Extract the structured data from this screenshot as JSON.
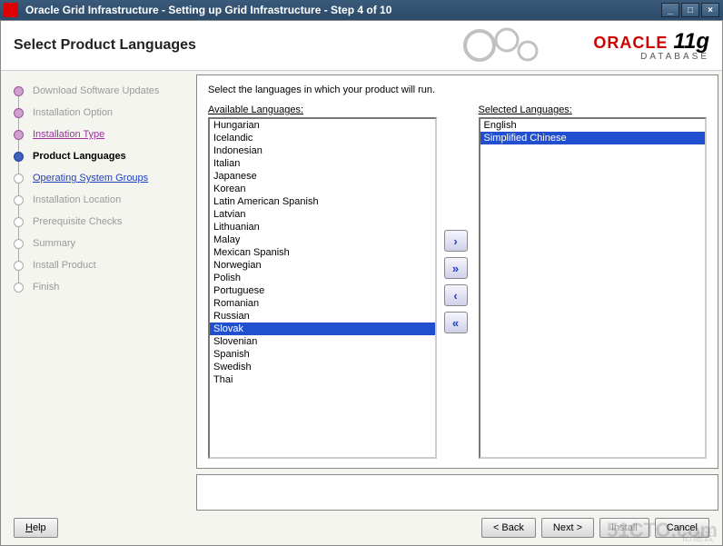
{
  "window": {
    "title": "Oracle Grid Infrastructure - Setting up Grid Infrastructure - Step 4 of 10"
  },
  "header": {
    "title": "Select Product Languages",
    "logo_brand": "ORACLE",
    "logo_product": "11g",
    "logo_sub": "DATABASE"
  },
  "steps": [
    {
      "label": "Download Software Updates",
      "state": "disabled"
    },
    {
      "label": "Installation Option",
      "state": "disabled"
    },
    {
      "label": "Installation Type",
      "state": "visited-link"
    },
    {
      "label": "Product Languages",
      "state": "current"
    },
    {
      "label": "Operating System Groups",
      "state": "link"
    },
    {
      "label": "Installation Location",
      "state": "disabled"
    },
    {
      "label": "Prerequisite Checks",
      "state": "disabled"
    },
    {
      "label": "Summary",
      "state": "disabled"
    },
    {
      "label": "Install Product",
      "state": "disabled"
    },
    {
      "label": "Finish",
      "state": "disabled"
    }
  ],
  "main": {
    "instruction": "Select the languages in which your product will run.",
    "available_label": "Available Languages:",
    "selected_label": "Selected Languages:",
    "available": [
      "Hungarian",
      "Icelandic",
      "Indonesian",
      "Italian",
      "Japanese",
      "Korean",
      "Latin American Spanish",
      "Latvian",
      "Lithuanian",
      "Malay",
      "Mexican Spanish",
      "Norwegian",
      "Polish",
      "Portuguese",
      "Romanian",
      "Russian",
      "Slovak",
      "Slovenian",
      "Spanish",
      "Swedish",
      "Thai"
    ],
    "available_selected_index": 16,
    "selected": [
      "English",
      "Simplified Chinese"
    ],
    "selected_selected_index": 1
  },
  "transfer": {
    "add": "›",
    "add_all": "»",
    "remove": "‹",
    "remove_all": "«"
  },
  "footer": {
    "help": "Help",
    "back": "< Back",
    "next": "Next >",
    "install": "Install",
    "cancel": "Cancel"
  },
  "watermark": "51CTO.com",
  "watermark2": "亿速云"
}
